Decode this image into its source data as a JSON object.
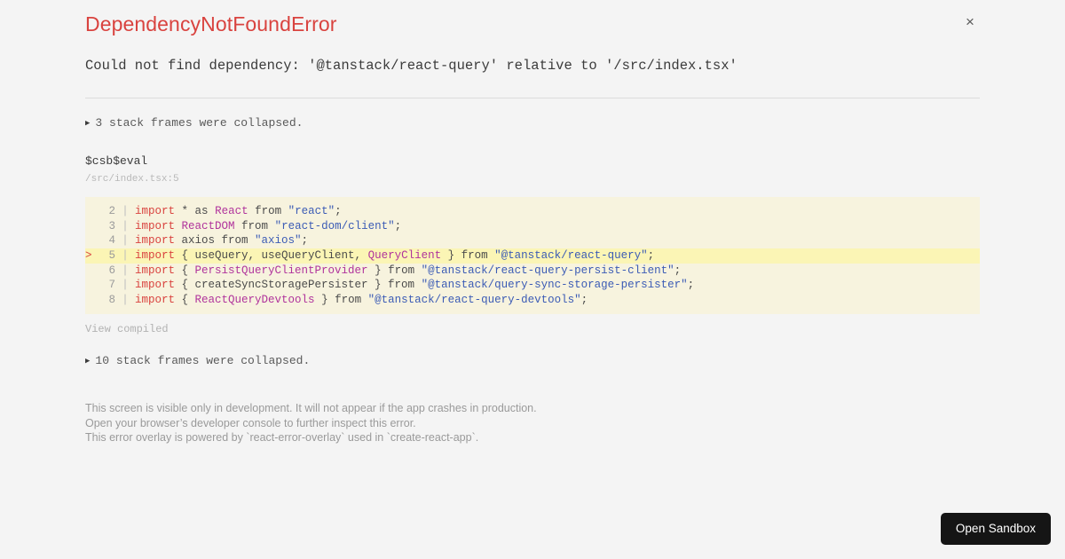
{
  "error": {
    "title": "DependencyNotFoundError",
    "message": "Could not find dependency: '@tanstack/react-query' relative to '/src/index.tsx'",
    "title_color": "#d9433f",
    "close_icon": "×"
  },
  "collapsed_top": {
    "triangle": "▶",
    "label": "3 stack frames were collapsed."
  },
  "frame": {
    "function_name": "$csb$eval",
    "location": "/src/index.tsx:5"
  },
  "code": {
    "highlight_marker": ">",
    "gutter_separator": "|",
    "lines": [
      {
        "number": "2",
        "marker": "",
        "highlighted": false,
        "tokens": [
          {
            "t": "import",
            "c": "kw"
          },
          {
            "t": " * ",
            "c": "def"
          },
          {
            "t": "as",
            "c": "def"
          },
          {
            "t": " ",
            "c": "def"
          },
          {
            "t": "React",
            "c": "id"
          },
          {
            "t": " from ",
            "c": "def"
          },
          {
            "t": "\"react\"",
            "c": "str"
          },
          {
            "t": ";",
            "c": "def"
          }
        ]
      },
      {
        "number": "3",
        "marker": "",
        "highlighted": false,
        "tokens": [
          {
            "t": "import",
            "c": "kw"
          },
          {
            "t": " ",
            "c": "def"
          },
          {
            "t": "ReactDOM",
            "c": "id"
          },
          {
            "t": " from ",
            "c": "def"
          },
          {
            "t": "\"react-dom/client\"",
            "c": "str"
          },
          {
            "t": ";",
            "c": "def"
          }
        ]
      },
      {
        "number": "4",
        "marker": "",
        "highlighted": false,
        "tokens": [
          {
            "t": "import",
            "c": "kw"
          },
          {
            "t": " axios from ",
            "c": "def"
          },
          {
            "t": "\"axios\"",
            "c": "str"
          },
          {
            "t": ";",
            "c": "def"
          }
        ]
      },
      {
        "number": "5",
        "marker": ">",
        "highlighted": true,
        "tokens": [
          {
            "t": "import",
            "c": "kw"
          },
          {
            "t": " { useQuery, useQueryClient, ",
            "c": "def"
          },
          {
            "t": "QueryClient",
            "c": "id"
          },
          {
            "t": " } from ",
            "c": "def"
          },
          {
            "t": "\"@tanstack/react-query\"",
            "c": "str"
          },
          {
            "t": ";",
            "c": "def"
          }
        ]
      },
      {
        "number": "6",
        "marker": "",
        "highlighted": false,
        "tokens": [
          {
            "t": "import",
            "c": "kw"
          },
          {
            "t": " { ",
            "c": "def"
          },
          {
            "t": "PersistQueryClientProvider",
            "c": "id"
          },
          {
            "t": " } from ",
            "c": "def"
          },
          {
            "t": "\"@tanstack/react-query-persist-client\"",
            "c": "str"
          },
          {
            "t": ";",
            "c": "def"
          }
        ]
      },
      {
        "number": "7",
        "marker": "",
        "highlighted": false,
        "tokens": [
          {
            "t": "import",
            "c": "kw"
          },
          {
            "t": " { createSyncStoragePersister } from ",
            "c": "def"
          },
          {
            "t": "\"@tanstack/query-sync-storage-persister\"",
            "c": "str"
          },
          {
            "t": ";",
            "c": "def"
          }
        ]
      },
      {
        "number": "8",
        "marker": "",
        "highlighted": false,
        "tokens": [
          {
            "t": "import",
            "c": "kw"
          },
          {
            "t": " { ",
            "c": "def"
          },
          {
            "t": "ReactQueryDevtools",
            "c": "id"
          },
          {
            "t": " } from ",
            "c": "def"
          },
          {
            "t": "\"@tanstack/react-query-devtools\"",
            "c": "str"
          },
          {
            "t": ";",
            "c": "def"
          }
        ]
      }
    ],
    "background": "#f7f3de",
    "highlight_background": "#fbf5b5"
  },
  "view_compiled": "View compiled",
  "collapsed_bottom": {
    "triangle": "▶",
    "label": "10 stack frames were collapsed."
  },
  "footer": {
    "lines": [
      "This screen is visible only in development. It will not appear if the app crashes in production.",
      "Open your browser’s developer console to further inspect this error.",
      "This error overlay is powered by `react-error-overlay` used in `create-react-app`."
    ]
  },
  "open_sandbox": {
    "label": "Open Sandbox"
  }
}
